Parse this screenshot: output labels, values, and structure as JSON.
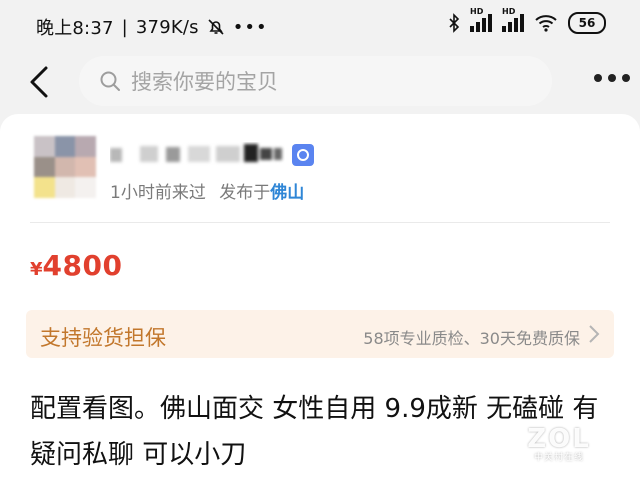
{
  "status_bar": {
    "time": "晚上8:37",
    "net_speed": "379K/s",
    "battery": "56",
    "icons": [
      "bell-off-icon",
      "more-dots-icon",
      "bluetooth-icon",
      "hd-signal-icon",
      "hd-signal-icon",
      "wifi-icon",
      "battery-icon"
    ]
  },
  "nav": {
    "back_icon": "chevron-left-icon",
    "search_placeholder": "搜索你要的宝贝",
    "more_icon": "more-horizontal-icon"
  },
  "seller": {
    "verify_icon": "verified-badge-icon",
    "last_active": "1小时前来过",
    "published_in_prefix": "发布于",
    "location": "佛山"
  },
  "listing": {
    "currency": "¥",
    "price": "4800",
    "guarantee_label": "支持验货担保",
    "guarantee_detail": "58项专业质检、30天免费质保",
    "description": "配置看图。佛山面交 女性自用 9.9成新 无磕碰  有疑问私聊 可以小刀"
  },
  "watermark": {
    "brand": "ZOL",
    "tagline": "中关村在线"
  },
  "colors": {
    "price": "#e1402e",
    "guarantee_bg": "#fdf2e8",
    "guarantee_text": "#c2772c",
    "location_link": "#2f86d6",
    "verify_badge": "#5a84f0"
  }
}
